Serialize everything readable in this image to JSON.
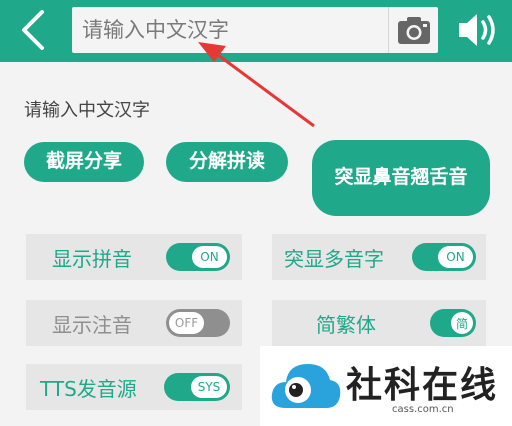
{
  "header": {
    "search_placeholder": "请输入中文汉字",
    "icons": {
      "back": "chevron-left-icon",
      "camera": "camera-icon",
      "speaker": "speaker-icon"
    }
  },
  "prompt_text": "请输入中文汉字",
  "actions": {
    "screenshot_share": "截屏分享",
    "split_pinyin": "分解拼读",
    "highlight_nasal": "突显鼻音翘舌音"
  },
  "options": {
    "show_pinyin": {
      "label": "显示拼音",
      "toggle": "ON",
      "state": "on"
    },
    "show_zhuyin": {
      "label": "显示注音",
      "toggle": "OFF",
      "state": "off"
    },
    "tts_source": {
      "label": "TTS发音源",
      "toggle": "SYS",
      "state": "on"
    },
    "highlight_polyphonic": {
      "label": "突显多音字",
      "toggle": "ON",
      "state": "on"
    },
    "simp_trad": {
      "label": "简繁体",
      "toggle": "简",
      "state": "on"
    }
  },
  "watermark": {
    "title": "社科在线",
    "url": "cass.com.cn"
  },
  "colors": {
    "accent": "#1fa88a",
    "background": "#f3f3f3",
    "arrow": "#e53935"
  }
}
